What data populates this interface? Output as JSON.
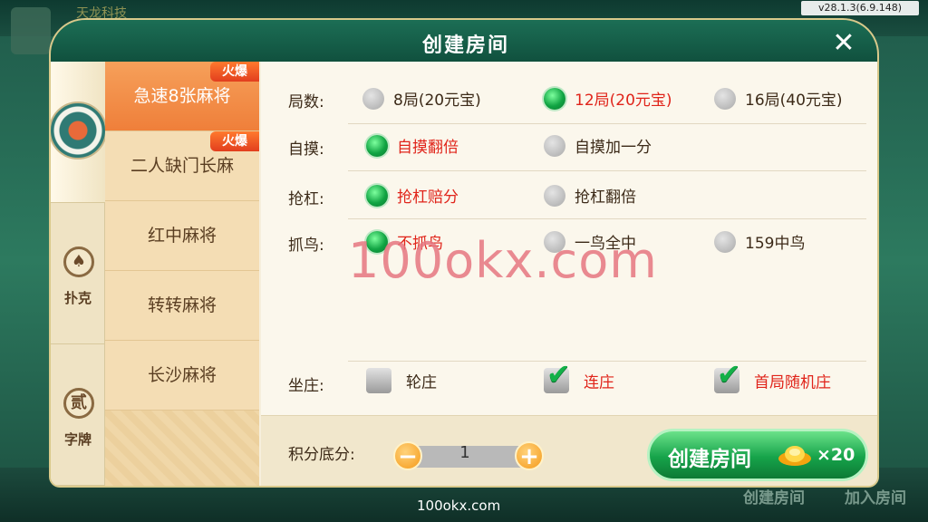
{
  "version": "v28.1.3(6.9.148)",
  "background": {
    "brand": "天龙科技",
    "bottom_menu": [
      "创建房间",
      "加入房间"
    ]
  },
  "dialog": {
    "title": "创建房间"
  },
  "categories": [
    {
      "label": "",
      "icon": "mahjong-emblem-icon"
    },
    {
      "label": "扑克",
      "icon": "spade-icon",
      "glyph": "♠"
    },
    {
      "label": "字牌",
      "icon": "zipai-icon",
      "glyph": "贰"
    }
  ],
  "games": [
    {
      "label": "急速8张麻将",
      "hot": "火爆"
    },
    {
      "label": "二人缺门长麻",
      "hot": "火爆"
    },
    {
      "label": "红中麻将"
    },
    {
      "label": "转转麻将"
    },
    {
      "label": "长沙麻将"
    }
  ],
  "options": {
    "rounds": {
      "label": "局数:",
      "choices": [
        "8局(20元宝)",
        "12局(20元宝)",
        "16局(40元宝)"
      ],
      "selected": 1
    },
    "zimo": {
      "label": "自摸:",
      "choices": [
        "自摸翻倍",
        "自摸加一分"
      ],
      "selected": 0
    },
    "qianggang": {
      "label": "抢杠:",
      "choices": [
        "抢杠赔分",
        "抢杠翻倍"
      ],
      "selected": 0
    },
    "zhuaniao": {
      "label": "抓鸟:",
      "choices": [
        "不抓鸟",
        "一鸟全中",
        "159中鸟"
      ],
      "selected": 0
    },
    "zuozhuang": {
      "label": "坐庄:",
      "choices": [
        "轮庄",
        "连庄",
        "首局随机庄"
      ],
      "checked": [
        false,
        true,
        true
      ]
    }
  },
  "score": {
    "label": "积分底分:",
    "value": "1"
  },
  "create_button": {
    "label": "创建房间",
    "cost": "×20"
  },
  "watermark": "100okx.com",
  "footer_url": "100okx.com",
  "colors": {
    "accent_green": "#16a34a",
    "selected_red": "#e0241a",
    "hot_orange": "#ef7f3a"
  }
}
